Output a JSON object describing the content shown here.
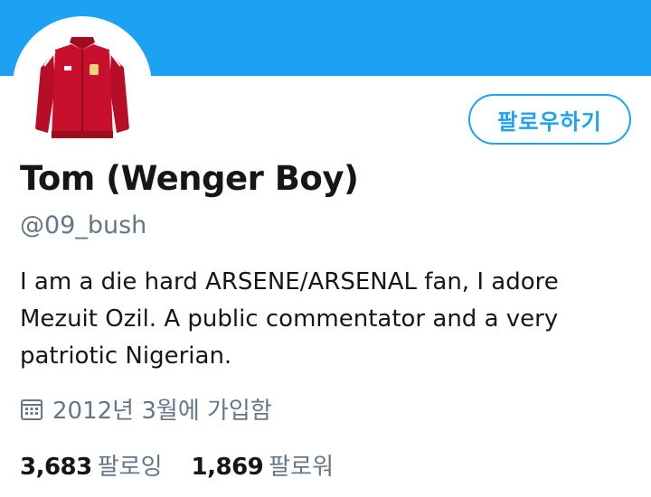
{
  "colors": {
    "banner": "#1da1f2",
    "accent": "#1da1f2",
    "secondary_text": "#657786",
    "primary_text": "#14171a",
    "jacket_red": "#c8102e"
  },
  "profile": {
    "avatar_icon": "red-arsenal-jacket",
    "display_name": "Tom (Wenger Boy)",
    "handle": "@09_bush",
    "bio": "I am a die hard ARSENE/ARSENAL fan, I adore Mezuit Ozil. A public commentator and a very patriotic Nigerian.",
    "joined_icon": "calendar-icon",
    "joined": "2012년 3월에 가입함"
  },
  "actions": {
    "follow_label": "팔로우하기"
  },
  "stats": {
    "following_count": "3,683",
    "following_label": "팔로잉",
    "followers_count": "1,869",
    "followers_label": "팔로워"
  }
}
